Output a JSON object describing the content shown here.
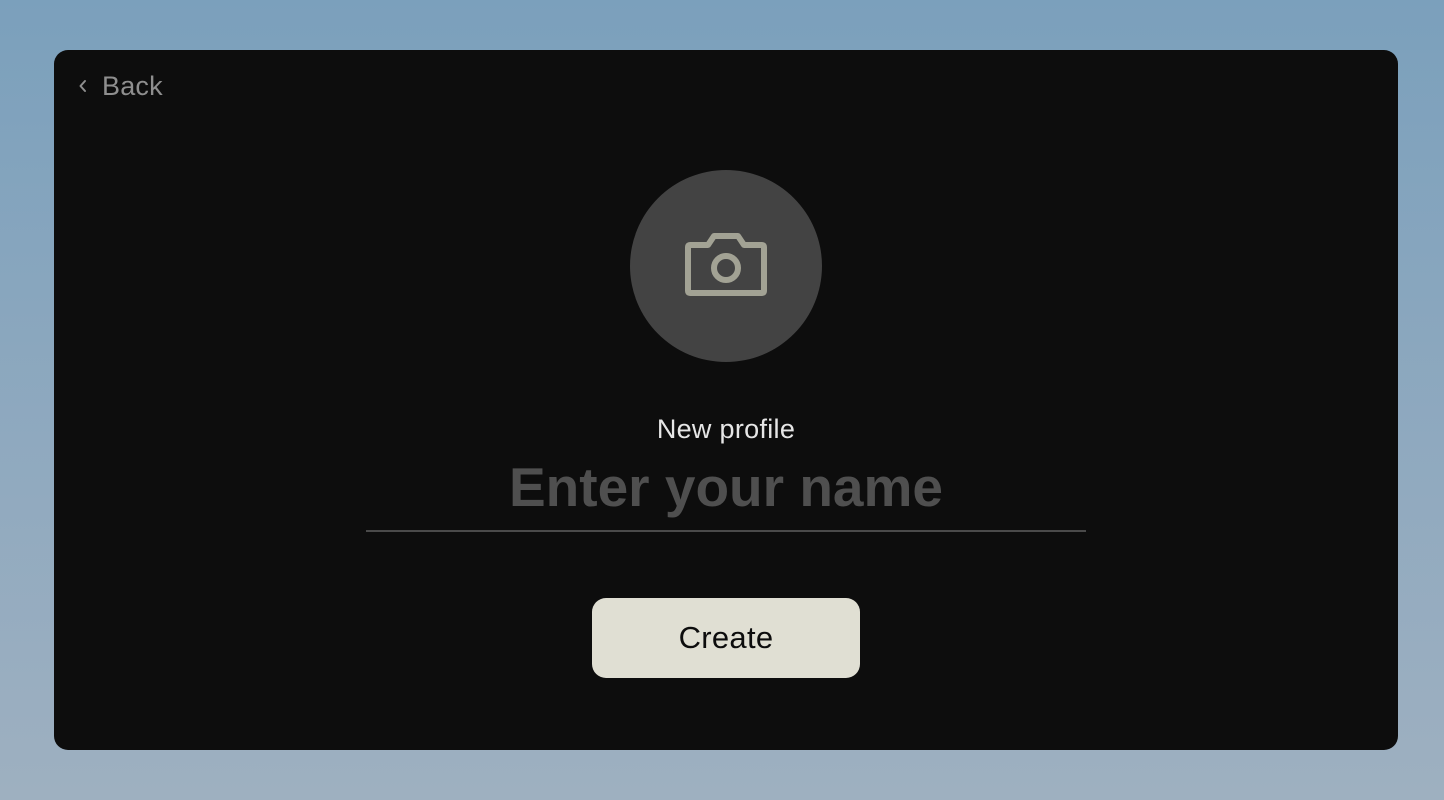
{
  "nav": {
    "back_label": "Back",
    "back_icon": "chevron-left-icon"
  },
  "avatar": {
    "icon": "camera-icon",
    "background_color": "#434343",
    "icon_color": "#a2a294"
  },
  "form": {
    "subtitle": "New profile",
    "name_placeholder": "Enter your name",
    "name_value": ""
  },
  "actions": {
    "create_label": "Create"
  },
  "colors": {
    "window_background": "#0d0d0d",
    "button_background": "#e0dfd3",
    "page_gradient_top": "#7ba0bc",
    "page_gradient_bottom": "#9eb0c0"
  }
}
